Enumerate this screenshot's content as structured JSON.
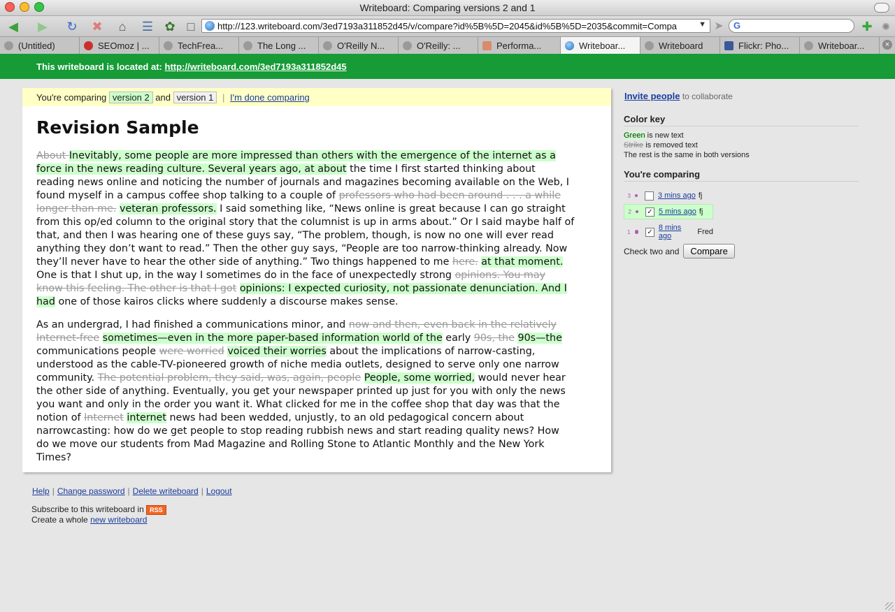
{
  "window": {
    "title": "Writeboard: Comparing versions 2 and 1"
  },
  "toolbar": {
    "url": "http://123.writeboard.com/3ed7193a311852d45/v/compare?id%5B%5D=2045&id%5B%5D=2035&commit=Compa",
    "search_placeholder": ""
  },
  "tabs": [
    {
      "label": "(Untitled)",
      "icon": "blank-icon"
    },
    {
      "label": "SEOmoz | ...",
      "icon": "seomoz-icon"
    },
    {
      "label": "TechFrea...",
      "icon": "page-icon"
    },
    {
      "label": "The Long ...",
      "icon": "page-icon"
    },
    {
      "label": "O'Reilly N...",
      "icon": "page-icon"
    },
    {
      "label": "O'Reilly: ...",
      "icon": "page-icon"
    },
    {
      "label": "Performa...",
      "icon": "doc-icon"
    },
    {
      "label": "Writeboar...",
      "icon": "globe-icon",
      "active": true
    },
    {
      "label": "Writeboard",
      "icon": "page-icon"
    },
    {
      "label": "Flickr: Pho...",
      "icon": "facebook-icon"
    },
    {
      "label": "Writeboar...",
      "icon": "page-icon"
    }
  ],
  "location": {
    "label": "This writeboard is located at:",
    "url": "http://writeboard.com/3ed7193a311852d45"
  },
  "compare": {
    "prefix": "You're comparing",
    "new_version": "version 2",
    "and": "and",
    "old_version": "version 1",
    "done": "I'm done comparing"
  },
  "doc": {
    "title": "Revision Sample",
    "paragraphs": [
      [
        {
          "t": "About ",
          "k": "del"
        },
        {
          "t": "Inevitably, some people are more impressed than others with the emergence of the internet as a force in the news reading culture. Several years ago, at about",
          "k": "ins"
        },
        {
          "t": " the time I first started thinking about reading news online and noticing the number of journals and magazines becoming available on the Web, I found myself in a campus coffee shop talking to a couple of ",
          "k": ""
        },
        {
          "t": "professors who had been around . . . a while longer than me.",
          "k": "del"
        },
        {
          "t": " ",
          "k": ""
        },
        {
          "t": "veteran professors.",
          "k": "ins"
        },
        {
          "t": " I said something like, “News online is great because I can go straight from this op/ed column to the original story that the columnist is up in arms about.” Or I said maybe half of that, and then I was hearing one of these guys say, “The problem, though, is now no one will ever read anything they don’t want to read.” Then the other guy says, “People are too narrow-thinking already. Now they’ll never have to hear the other side of anything.” Two things happened to me ",
          "k": ""
        },
        {
          "t": "here.",
          "k": "del"
        },
        {
          "t": " ",
          "k": ""
        },
        {
          "t": "at that moment.",
          "k": "ins"
        },
        {
          "t": " One is that I shut up, in the way I sometimes do in the face of unexpectedly strong ",
          "k": ""
        },
        {
          "t": "opinions. You may know this feeling. The other is that I got",
          "k": "del"
        },
        {
          "t": " ",
          "k": ""
        },
        {
          "t": "opinions: I expected curiosity, not passionate denunciation. And I had",
          "k": "ins"
        },
        {
          "t": " one of those kairos clicks where suddenly a discourse makes sense.",
          "k": ""
        }
      ],
      [
        {
          "t": "As an undergrad, I had finished a communications minor, and ",
          "k": ""
        },
        {
          "t": "now and then, even back in the relatively Internet-free",
          "k": "del"
        },
        {
          "t": " ",
          "k": ""
        },
        {
          "t": "sometimes—even in the more paper-based information world of the",
          "k": "ins"
        },
        {
          "t": " early ",
          "k": ""
        },
        {
          "t": "90s, the",
          "k": "del"
        },
        {
          "t": " ",
          "k": ""
        },
        {
          "t": "90s—the",
          "k": "ins"
        },
        {
          "t": " communications people ",
          "k": ""
        },
        {
          "t": "were worried",
          "k": "del"
        },
        {
          "t": " ",
          "k": ""
        },
        {
          "t": "voiced their worries",
          "k": "ins"
        },
        {
          "t": " about the implications of narrow-casting, understood as the cable-TV-pioneered growth of niche media outlets, designed to serve only one narrow community. ",
          "k": ""
        },
        {
          "t": "The potential problem, they said, was, again, people",
          "k": "del"
        },
        {
          "t": " ",
          "k": ""
        },
        {
          "t": "People, some worried,",
          "k": "ins"
        },
        {
          "t": " would never hear the other side of anything. Eventually, you get your newspaper printed up just for you with only the news you want and only in the order you want it. What clicked for me in the coffee shop that day was that the notion of ",
          "k": ""
        },
        {
          "t": "Internet",
          "k": "del"
        },
        {
          "t": " ",
          "k": ""
        },
        {
          "t": "internet",
          "k": "ins"
        },
        {
          "t": " news had been wedded, unjustly, to an old pedagogical concern about narrowcasting: how do we get people to stop reading rubbish news and start reading quality news? How do we move our students from Mad Magazine and Rolling Stone to Atlantic Monthly and the New York Times?",
          "k": ""
        }
      ]
    ]
  },
  "sidebar": {
    "invite_link": "Invite people",
    "invite_suffix": "to collaborate",
    "color_key_heading": "Color key",
    "key_green": "Green",
    "key_green_suffix": "is new text",
    "key_strike": "Strike",
    "key_strike_suffix": "is removed text",
    "key_rest": "The rest is the same in both versions",
    "comparing_heading": "You're comparing",
    "versions": [
      {
        "num": "3",
        "checked": false,
        "time": "3 mins ago",
        "author": "fj",
        "selected": false
      },
      {
        "num": "2",
        "checked": true,
        "time": "5 mins ago",
        "author": "fj",
        "selected": true
      },
      {
        "num": "1",
        "checked": true,
        "time": "8 mins ago",
        "author": "Fred",
        "selected": false
      }
    ],
    "check_two": "Check two and",
    "compare_button": "Compare"
  },
  "footer": {
    "links": [
      "Help",
      "Change password",
      "Delete writeboard",
      "Logout"
    ],
    "subscribe": "Subscribe to this writeboard in",
    "rss": "RSS",
    "create_prefix": "Create a whole",
    "create_link": "new writeboard"
  },
  "colors": {
    "accent_green": "#169b37",
    "insert_bg": "#ccffcc",
    "compare_bar_bg": "#ffffc6"
  }
}
